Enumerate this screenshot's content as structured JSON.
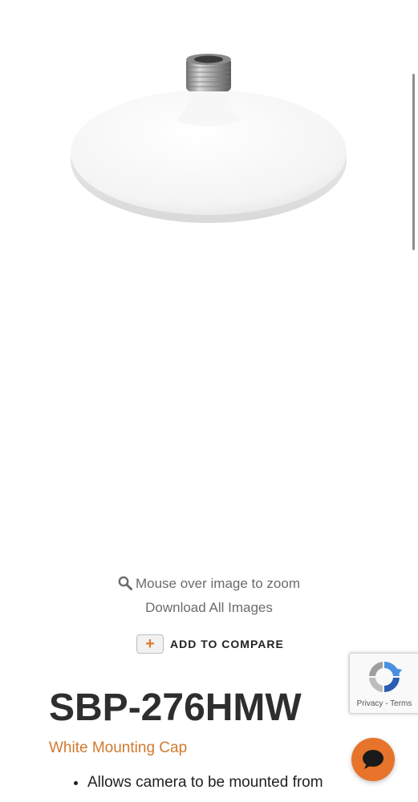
{
  "gallery": {
    "zoom_hint": "Mouse over image to zoom",
    "download_label": "Download All Images"
  },
  "compare": {
    "plus_symbol": "+",
    "label": "ADD TO COMPARE"
  },
  "recaptcha": {
    "links_text": "Privacy - Terms"
  },
  "product": {
    "title": "SBP-276HMW",
    "subtitle": "White Mounting Cap",
    "features": [
      "Allows camera to be mounted from"
    ]
  },
  "colors": {
    "accent": "#e7742a",
    "subtitle": "#d17a2f",
    "heading": "#2e2e2e"
  },
  "icons": {
    "zoom": "search-icon",
    "chat": "chat-bubble-icon",
    "recaptcha": "recaptcha-logo-icon"
  }
}
